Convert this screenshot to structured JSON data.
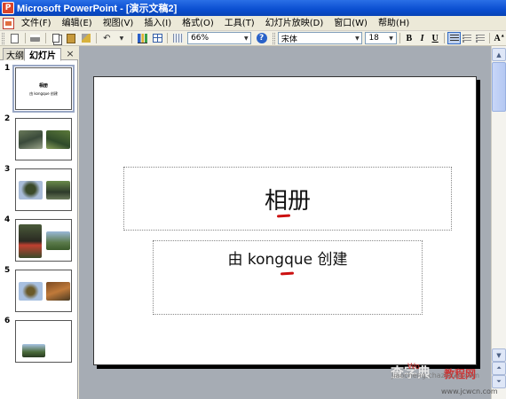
{
  "window": {
    "title": "Microsoft PowerPoint - [演示文稿2]"
  },
  "menu": {
    "items": [
      "文件(F)",
      "编辑(E)",
      "视图(V)",
      "插入(I)",
      "格式(O)",
      "工具(T)",
      "幻灯片放映(D)",
      "窗口(W)",
      "帮助(H)"
    ]
  },
  "toolbar": {
    "zoom": "66%",
    "font": "宋体",
    "font_size": "18",
    "bold": "B",
    "italic": "I",
    "underline": "U"
  },
  "left_pane": {
    "tab_outline": "大纲",
    "tab_slides": "幻灯片",
    "close": "×",
    "slides": [
      {
        "number": "1",
        "title": "相册",
        "subtitle": "由 kongque 创建"
      },
      {
        "number": "2"
      },
      {
        "number": "3"
      },
      {
        "number": "4"
      },
      {
        "number": "5"
      },
      {
        "number": "6"
      }
    ]
  },
  "slide": {
    "title": "相册",
    "subtitle": "由 kongque 创建"
  },
  "watermark": {
    "url": "jiaocheng.chazidian.com",
    "site": "www.jcwcn.com",
    "brand": "查字典",
    "brand2": "教程网",
    "logo": "Wo"
  },
  "colors": {
    "titlebar": "#0a4ed0",
    "workspace": "#a6acb4",
    "red_mark": "#cc1111"
  }
}
